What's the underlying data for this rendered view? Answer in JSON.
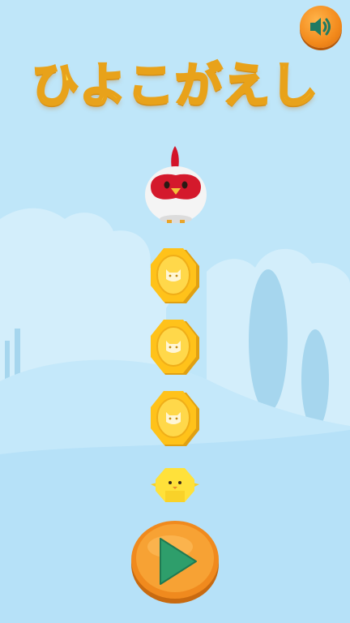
{
  "game": {
    "title": "ひよこがえし"
  },
  "icons": {
    "sound": "speaker-volume-icon",
    "play": "play-triangle-icon",
    "coin": "cat-face-coin-icon",
    "rooster": "rooster-character",
    "chick": "chick-character"
  },
  "colors": {
    "sky": "#bfe6f9",
    "title_fill": "#ffe14a",
    "title_outline": "#e8a21a",
    "button_orange": "#f38a1c",
    "play_green": "#2e9e6b",
    "coin_gold": "#ffc21a"
  },
  "coins": [
    {
      "icon": "cat-face-coin-icon"
    },
    {
      "icon": "cat-face-coin-icon"
    },
    {
      "icon": "cat-face-coin-icon"
    }
  ]
}
